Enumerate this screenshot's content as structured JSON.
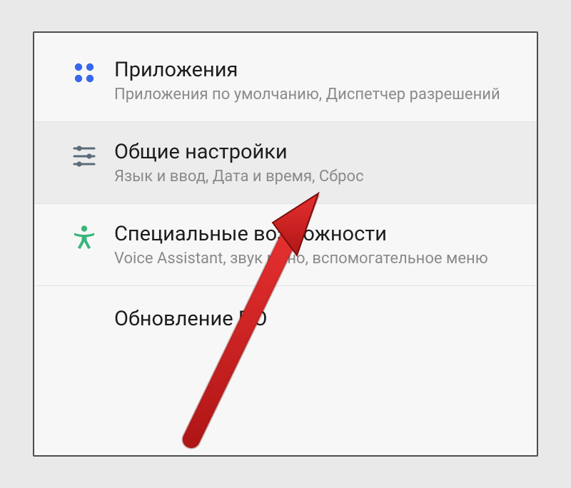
{
  "items": [
    {
      "title": "Приложения",
      "subtitle": "Приложения по умолчанию, Диспетчер разрешений",
      "icon": "apps-icon",
      "highlight": false
    },
    {
      "title": "Общие настройки",
      "subtitle": "Язык и ввод, Дата и время, Сброс",
      "icon": "sliders-icon",
      "highlight": true
    },
    {
      "title": "Специальные возможности",
      "subtitle": "Voice Assistant, звук моно, вспомогательное меню",
      "icon": "accessibility-icon",
      "highlight": false
    },
    {
      "title": "Обновление ПО",
      "subtitle": "",
      "icon": "",
      "highlight": false
    }
  ],
  "colors": {
    "apps": "#3767ea",
    "sliders": "#5a6b7a",
    "accessibility": "#39b57a",
    "arrow_fill": "#d32121",
    "arrow_stroke": "#7a0e0e"
  }
}
